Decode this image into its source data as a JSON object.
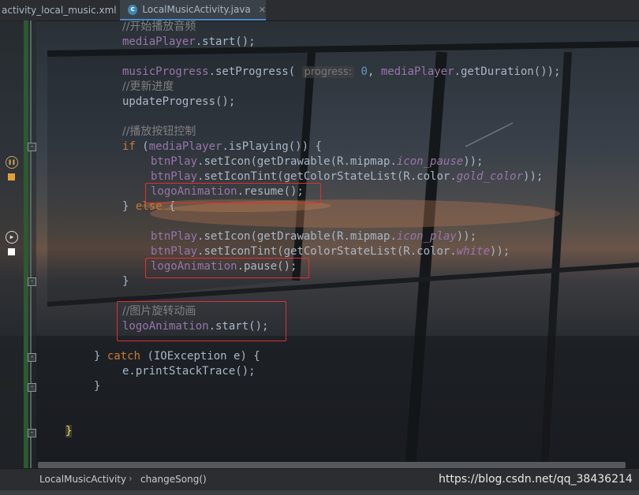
{
  "tabs": [
    {
      "label": "activity_local_music.xml",
      "active": false
    },
    {
      "label": "LocalMusicActivity.java",
      "active": true,
      "icon": "java-class-icon"
    }
  ],
  "code_lines": [
    "//开始播放音频",
    "mediaPlayer.start();",
    "",
    "musicProgress.setProgress( progress: 0, mediaPlayer.getDuration());",
    "//更新进度",
    "updateProgress();",
    "",
    "//播放按钮控制",
    "if (mediaPlayer.isPlaying()) {",
    "btnPlay.setIcon(getDrawable(R.mipmap.icon_pause));",
    "btnPlay.setIconTint(getColorStateList(R.color.gold_color));",
    "logoAnimation.resume();",
    "} else {",
    "",
    "btnPlay.setIcon(getDrawable(R.mipmap.icon_play));",
    "btnPlay.setIconTint(getColorStateList(R.color.white));",
    "logoAnimation.pause();",
    "}",
    "",
    "//图片旋转动画",
    "logoAnimation.start();",
    "",
    "} catch (IOException e) {",
    "e.printStackTrace();",
    "}",
    "",
    "",
    "}"
  ],
  "breadcrumb": {
    "class": "LocalMusicActivity",
    "method": "changeSong()"
  },
  "watermark": "https://blog.csdn.net/qq_38436214",
  "colors": {
    "keyword": "#cc7832",
    "field": "#9876aa",
    "comment": "#808080",
    "number": "#6897bb",
    "highlight_box": "#e03030"
  }
}
